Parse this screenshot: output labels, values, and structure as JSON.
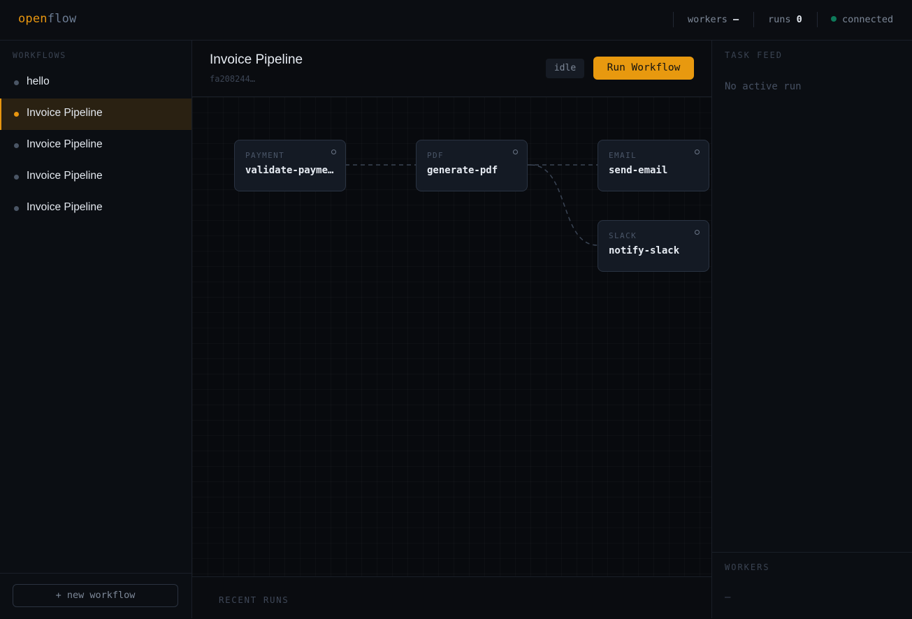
{
  "app": {
    "logo_part1": "open",
    "logo_part2": "flow"
  },
  "topbar": {
    "workers_label": "workers",
    "workers_value": "—",
    "runs_label": "runs",
    "runs_value": "0",
    "connection_status": "connected",
    "connection_color": "#0e7a5a"
  },
  "sidebar": {
    "heading": "WORKFLOWS",
    "items": [
      {
        "label": "hello",
        "active": false
      },
      {
        "label": "Invoice Pipeline",
        "active": true
      },
      {
        "label": "Invoice Pipeline",
        "active": false
      },
      {
        "label": "Invoice Pipeline",
        "active": false
      },
      {
        "label": "Invoice Pipeline",
        "active": false
      }
    ],
    "new_workflow_label": "+ new workflow"
  },
  "workflow": {
    "title": "Invoice Pipeline",
    "id": "fa208244…",
    "status": "idle",
    "run_button_label": "Run Workflow",
    "accent_color": "#e8990f"
  },
  "graph": {
    "nodes": [
      {
        "kind": "PAYMENT",
        "name": "validate-payme…"
      },
      {
        "kind": "PDF",
        "name": "generate-pdf"
      },
      {
        "kind": "EMAIL",
        "name": "send-email"
      },
      {
        "kind": "SLACK",
        "name": "notify-slack"
      }
    ],
    "edges": [
      {
        "from": "validate-payme…",
        "to": "generate-pdf"
      },
      {
        "from": "generate-pdf",
        "to": "send-email"
      },
      {
        "from": "generate-pdf",
        "to": "notify-slack"
      }
    ]
  },
  "recent_runs": {
    "heading": "RECENT RUNS"
  },
  "task_feed": {
    "heading": "TASK FEED",
    "empty_text": "No active run"
  },
  "workers_panel": {
    "heading": "WORKERS",
    "value": "—"
  }
}
